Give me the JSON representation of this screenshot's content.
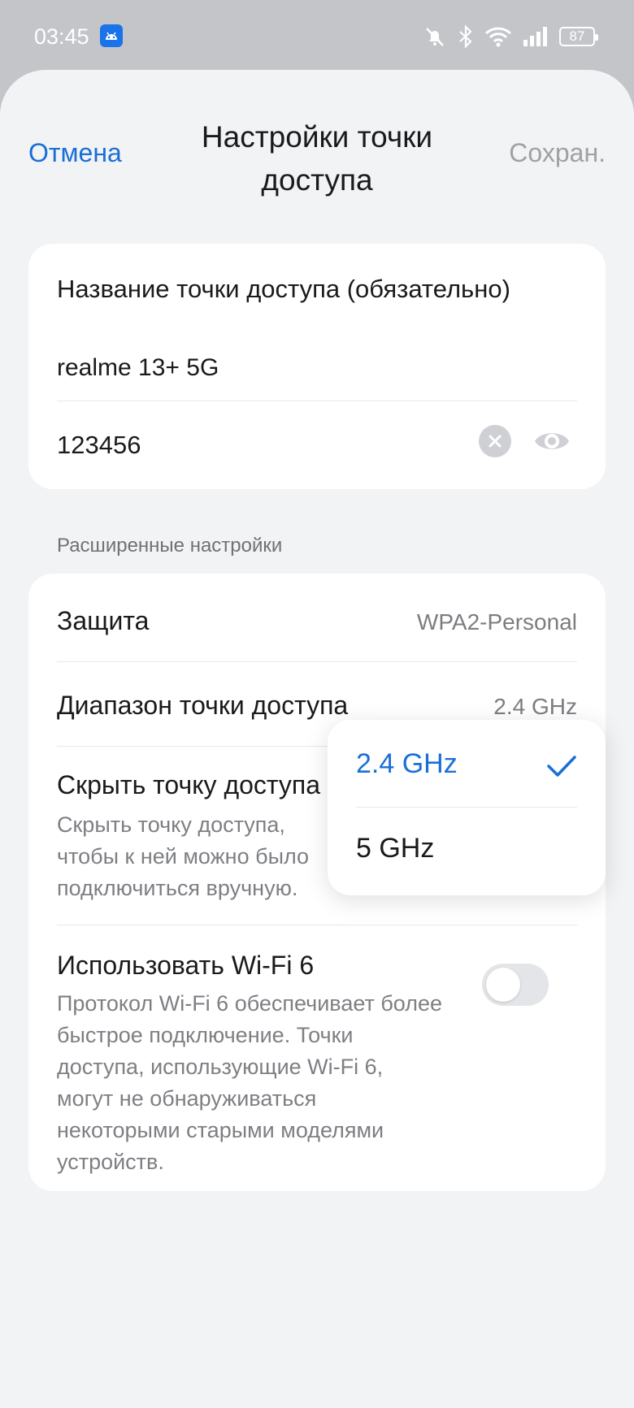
{
  "status_bar": {
    "time": "03:45",
    "battery": "87",
    "icons": [
      "android-icon",
      "mute-icon",
      "bluetooth-icon",
      "wifi-icon",
      "signal-icon",
      "battery-icon"
    ]
  },
  "header": {
    "cancel_label": "Отмена",
    "title": "Настройки точки доступа",
    "save_label": "Сохран."
  },
  "hotspot": {
    "name_label": "Название точки доступа (обязательно)",
    "name_value": "realme 13+ 5G",
    "password_value": "123456"
  },
  "advanced": {
    "caption": "Расширенные настройки",
    "security_label": "Защита",
    "security_value": "WPA2-Personal",
    "band_label": "Диапазон точки доступа",
    "band_value": "2.4 GHz",
    "hide_label": "Скрыть точку доступа",
    "hide_desc": "Скрыть точку доступа, чтобы к ней можно было подключиться вручную.",
    "wifi6_label": "Использовать Wi-Fi 6",
    "wifi6_desc": "Протокол Wi-Fi 6 обеспечивает более быстрое подключение. Точки доступа, использующие Wi-Fi 6, могут не обнаруживаться некоторыми старыми моделями устройств.",
    "wifi6_enabled": false
  },
  "band_dropdown": {
    "options": [
      "2.4 GHz",
      "5 GHz"
    ],
    "selected": "2.4 GHz"
  },
  "colors": {
    "accent": "#1a6fd6",
    "disabled_text": "#9fa1a5",
    "background": "#f2f3f5"
  }
}
